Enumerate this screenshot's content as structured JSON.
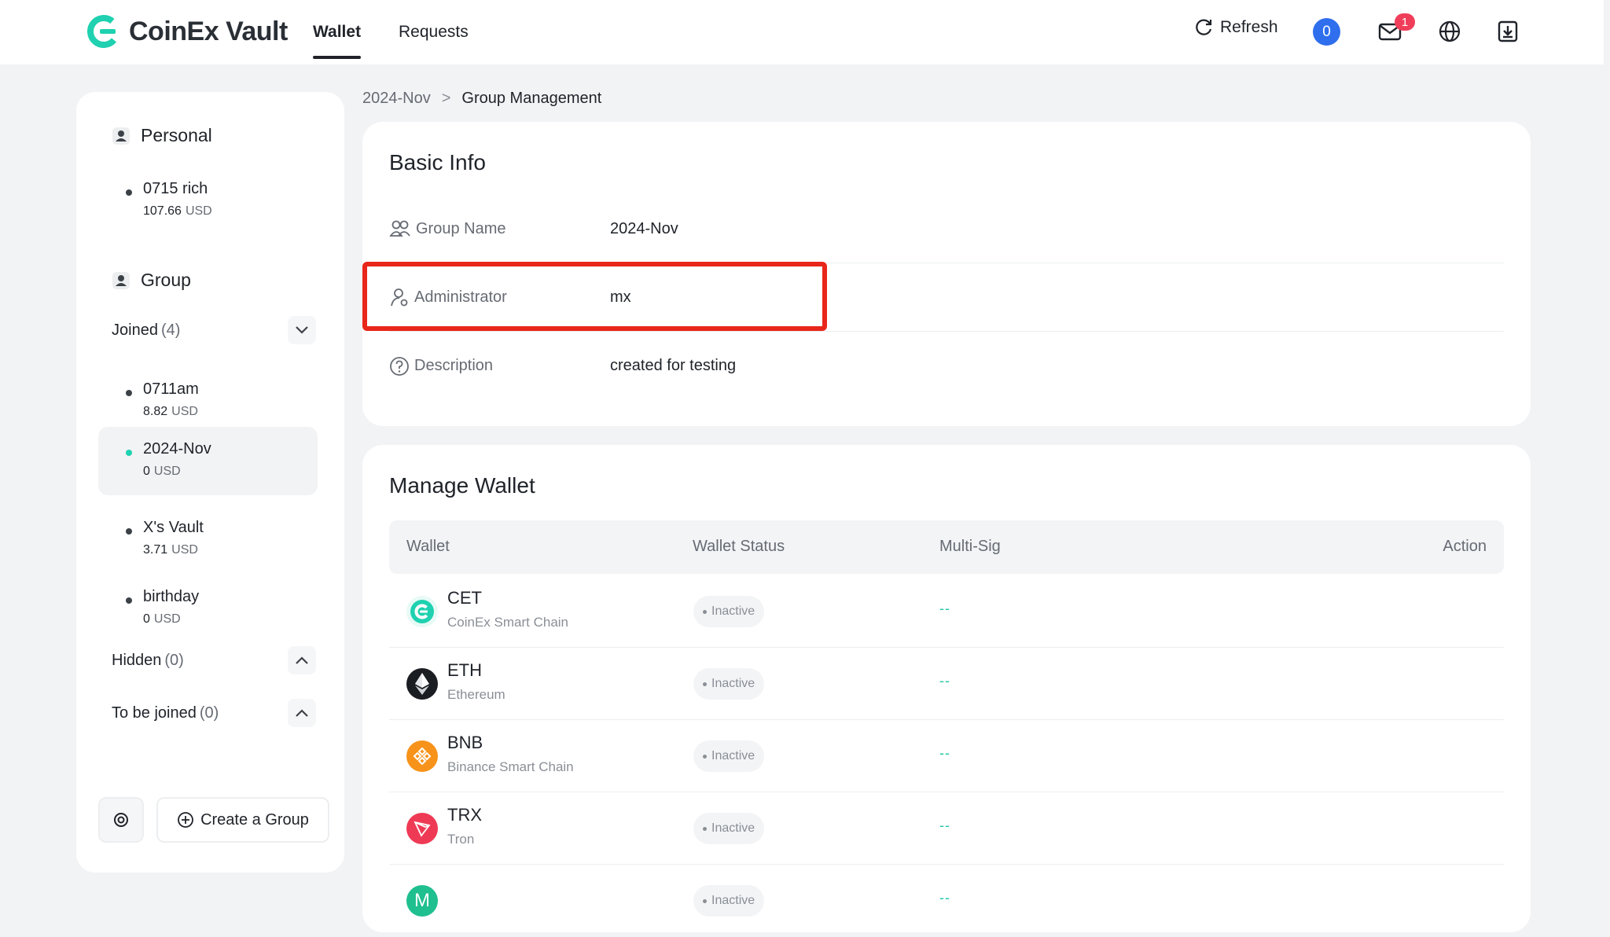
{
  "app": {
    "brand": "CoinEx Vault"
  },
  "nav": {
    "tabs": [
      {
        "label": "Wallet",
        "active": true
      },
      {
        "label": "Requests",
        "active": false
      }
    ]
  },
  "topbar": {
    "refresh_label": "Refresh",
    "pending_count": "0",
    "mail_badge": "1",
    "icons": [
      "refresh-icon",
      "mail-icon",
      "globe-icon",
      "download-icon"
    ]
  },
  "sidebar": {
    "personal": {
      "title": "Personal",
      "items": [
        {
          "name": "0715 rich",
          "amount": "107.66",
          "unit": "USD"
        }
      ]
    },
    "group": {
      "title": "Group",
      "joined": {
        "label": "Joined",
        "count": "(4)",
        "items": [
          {
            "name": "0711am",
            "amount": "8.82",
            "unit": "USD"
          },
          {
            "name": "2024-Nov",
            "amount": "0",
            "unit": "USD",
            "selected": true
          },
          {
            "name": "X's Vault",
            "amount": "3.71",
            "unit": "USD"
          },
          {
            "name": "birthday",
            "amount": "0",
            "unit": "USD"
          }
        ]
      },
      "hidden": {
        "label": "Hidden",
        "count": "(0)"
      },
      "to_be_joined": {
        "label": "To be joined",
        "count": "(0)"
      }
    },
    "create_group_label": "Create a Group"
  },
  "breadcrumb": {
    "parent": "2024-Nov",
    "separator": ">",
    "current": "Group Management"
  },
  "basic_info": {
    "title": "Basic Info",
    "rows": [
      {
        "label": "Group Name",
        "value": "2024-Nov"
      },
      {
        "label": "Administrator",
        "value": "mx"
      },
      {
        "label": "Description",
        "value": "created for testing"
      }
    ]
  },
  "manage_wallet": {
    "title": "Manage Wallet",
    "columns": {
      "wallet": "Wallet",
      "status": "Wallet Status",
      "multisig": "Multi-Sig",
      "action": "Action"
    },
    "rows": [
      {
        "symbol": "CET",
        "chain": "CoinEx Smart Chain",
        "status": "Inactive",
        "multisig": "--",
        "color": "#1fd1b0"
      },
      {
        "symbol": "ETH",
        "chain": "Ethereum",
        "status": "Inactive",
        "multisig": "--",
        "color": "#1a1d22"
      },
      {
        "symbol": "BNB",
        "chain": "Binance Smart Chain",
        "status": "Inactive",
        "multisig": "--",
        "color": "#f7931a"
      },
      {
        "symbol": "TRX",
        "chain": "Tron",
        "status": "Inactive",
        "multisig": "--",
        "color": "#ef3a55"
      },
      {
        "symbol": "",
        "chain": "",
        "status": "Inactive",
        "multisig": "--",
        "color": "#1fbf8f",
        "glyph": "M"
      }
    ]
  }
}
